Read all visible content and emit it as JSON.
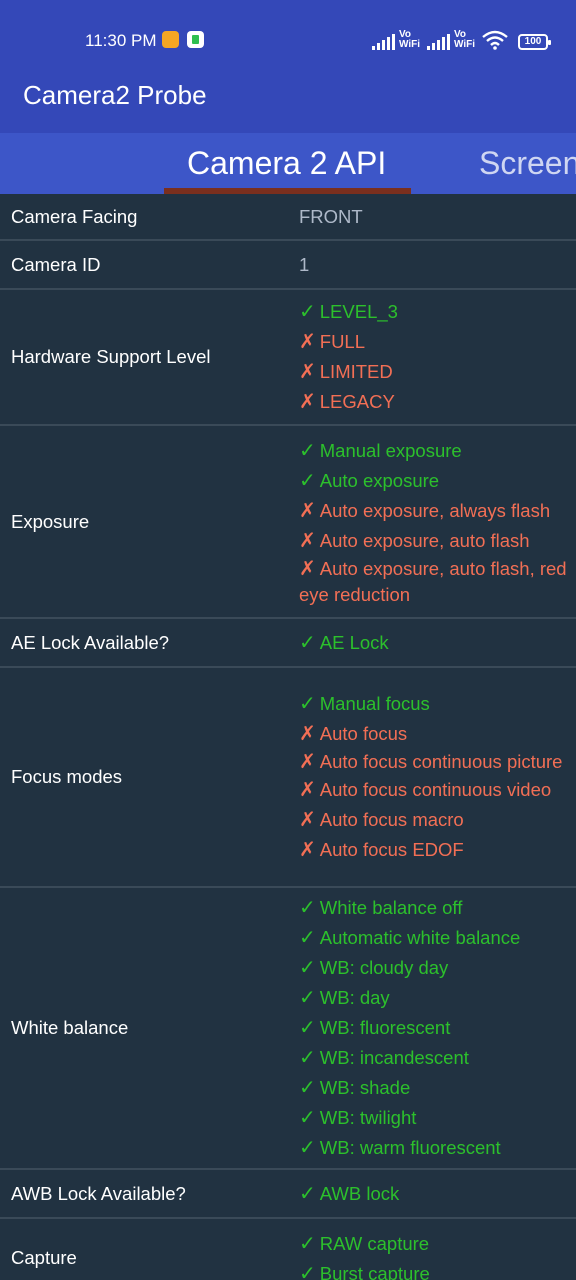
{
  "status_bar": {
    "time": "11:30 PM",
    "vowifi_1": "Vo WiFi",
    "vowifi_2": "Vo WiFi",
    "battery": "100",
    "icons": [
      "clock-app-icon",
      "sim-app-icon",
      "signal-icon",
      "wifi-icon",
      "battery-icon"
    ]
  },
  "app": {
    "title": "Camera2 Probe"
  },
  "tabs": [
    {
      "label": "Camera 2 API",
      "active": true
    },
    {
      "label": "Screen",
      "active": false
    }
  ],
  "colors": {
    "app_bar": "#3448b8",
    "tab_bar": "#3d56c8",
    "background": "#213241",
    "supported": "#2cc02c",
    "unsupported": "#f26f55",
    "indicator": "#7a2f1e"
  },
  "rows": {
    "camera_facing": {
      "label": "Camera Facing",
      "value": "FRONT"
    },
    "camera_id": {
      "label": "Camera ID",
      "value": "1"
    },
    "hardware_level": {
      "label": "Hardware Support Level",
      "features": [
        {
          "mark": "✓",
          "text": "LEVEL_3",
          "supported": true
        },
        {
          "mark": "✗",
          "text": "FULL",
          "supported": false
        },
        {
          "mark": "✗",
          "text": "LIMITED",
          "supported": false
        },
        {
          "mark": "✗",
          "text": "LEGACY",
          "supported": false
        }
      ]
    },
    "exposure": {
      "label": "Exposure",
      "features": [
        {
          "mark": "✓",
          "text": "Manual exposure",
          "supported": true
        },
        {
          "mark": "✓",
          "text": "Auto exposure",
          "supported": true
        },
        {
          "mark": "✗",
          "text": "Auto exposure, always flash",
          "supported": false
        },
        {
          "mark": "✗",
          "text": "Auto exposure, auto flash",
          "supported": false
        },
        {
          "mark": "✗",
          "text": "Auto exposure, auto flash, red eye reduction",
          "supported": false
        }
      ]
    },
    "ae_lock": {
      "label": "AE Lock Available?",
      "features": [
        {
          "mark": "✓",
          "text": "AE Lock",
          "supported": true
        }
      ]
    },
    "focus_modes": {
      "label": "Focus modes",
      "features": [
        {
          "mark": "✓",
          "text": "Manual focus",
          "supported": true
        },
        {
          "mark": "✗",
          "text": "Auto focus",
          "supported": false
        },
        {
          "mark": "✗",
          "text": "Auto focus continuous picture",
          "supported": false
        },
        {
          "mark": "✗",
          "text": "Auto focus continuous video",
          "supported": false
        },
        {
          "mark": "✗",
          "text": "Auto focus macro",
          "supported": false
        },
        {
          "mark": "✗",
          "text": "Auto focus EDOF",
          "supported": false
        }
      ]
    },
    "white_balance": {
      "label": "White balance",
      "features": [
        {
          "mark": "✓",
          "text": "White balance off",
          "supported": true
        },
        {
          "mark": "✓",
          "text": "Automatic white balance",
          "supported": true
        },
        {
          "mark": "✓",
          "text": "WB: cloudy day",
          "supported": true
        },
        {
          "mark": "✓",
          "text": "WB: day",
          "supported": true
        },
        {
          "mark": "✓",
          "text": "WB: fluorescent",
          "supported": true
        },
        {
          "mark": "✓",
          "text": "WB: incandescent",
          "supported": true
        },
        {
          "mark": "✓",
          "text": "WB: shade",
          "supported": true
        },
        {
          "mark": "✓",
          "text": "WB: twilight",
          "supported": true
        },
        {
          "mark": "✓",
          "text": "WB: warm fluorescent",
          "supported": true
        }
      ]
    },
    "awb_lock": {
      "label": "AWB Lock Available?",
      "features": [
        {
          "mark": "✓",
          "text": "AWB lock",
          "supported": true
        }
      ]
    },
    "capture": {
      "label": "Capture",
      "features": [
        {
          "mark": "✓",
          "text": "RAW capture",
          "supported": true
        },
        {
          "mark": "✓",
          "text": "Burst capture",
          "supported": true
        }
      ]
    }
  }
}
